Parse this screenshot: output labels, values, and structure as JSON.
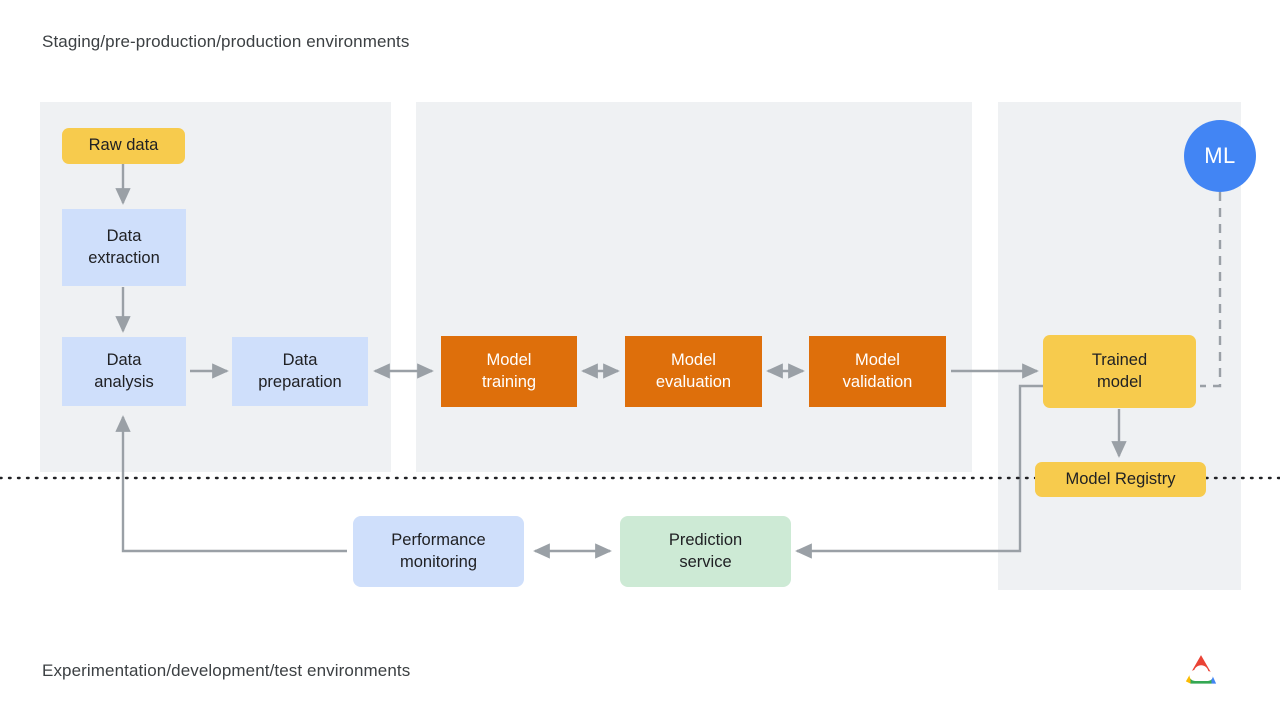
{
  "captions": {
    "top": "Staging/pre-production/production environments",
    "bottom": "Experimentation/development/test environments"
  },
  "colors": {
    "panel": "#eff1f3",
    "yellow": "#f7cb4d",
    "blue": "#cfdffb",
    "orange": "#de6f0b",
    "green": "#cdead5",
    "ml_blue": "#4285f4",
    "connector": "#9aa0a6",
    "text": "#202124",
    "caption_text": "#3c4043"
  },
  "panels": [
    {
      "name": "left-panel"
    },
    {
      "name": "middle-panel"
    },
    {
      "name": "right-panel"
    }
  ],
  "nodes": {
    "raw_data": "Raw data",
    "data_extraction": "Data\nextraction",
    "data_extraction_line1": "Data",
    "data_extraction_line2": "extraction",
    "data_analysis_line1": "Data",
    "data_analysis_line2": "analysis",
    "data_preparation_line1": "Data",
    "data_preparation_line2": "preparation",
    "model_training_line1": "Model",
    "model_training_line2": "training",
    "model_evaluation_line1": "Model",
    "model_evaluation_line2": "evaluation",
    "model_validation_line1": "Model",
    "model_validation_line2": "validation",
    "trained_model_line1": "Trained",
    "trained_model_line2": "model",
    "model_registry": "Model Registry",
    "performance_monitoring_line1": "Performance",
    "performance_monitoring_line2": "monitoring",
    "prediction_service_line1": "Prediction",
    "prediction_service_line2": "service",
    "ml_badge": "ML"
  },
  "logo": {
    "name": "google-cloud-logo",
    "colors": [
      "#ea4335",
      "#fbbc04",
      "#34a853",
      "#4285f4"
    ]
  }
}
